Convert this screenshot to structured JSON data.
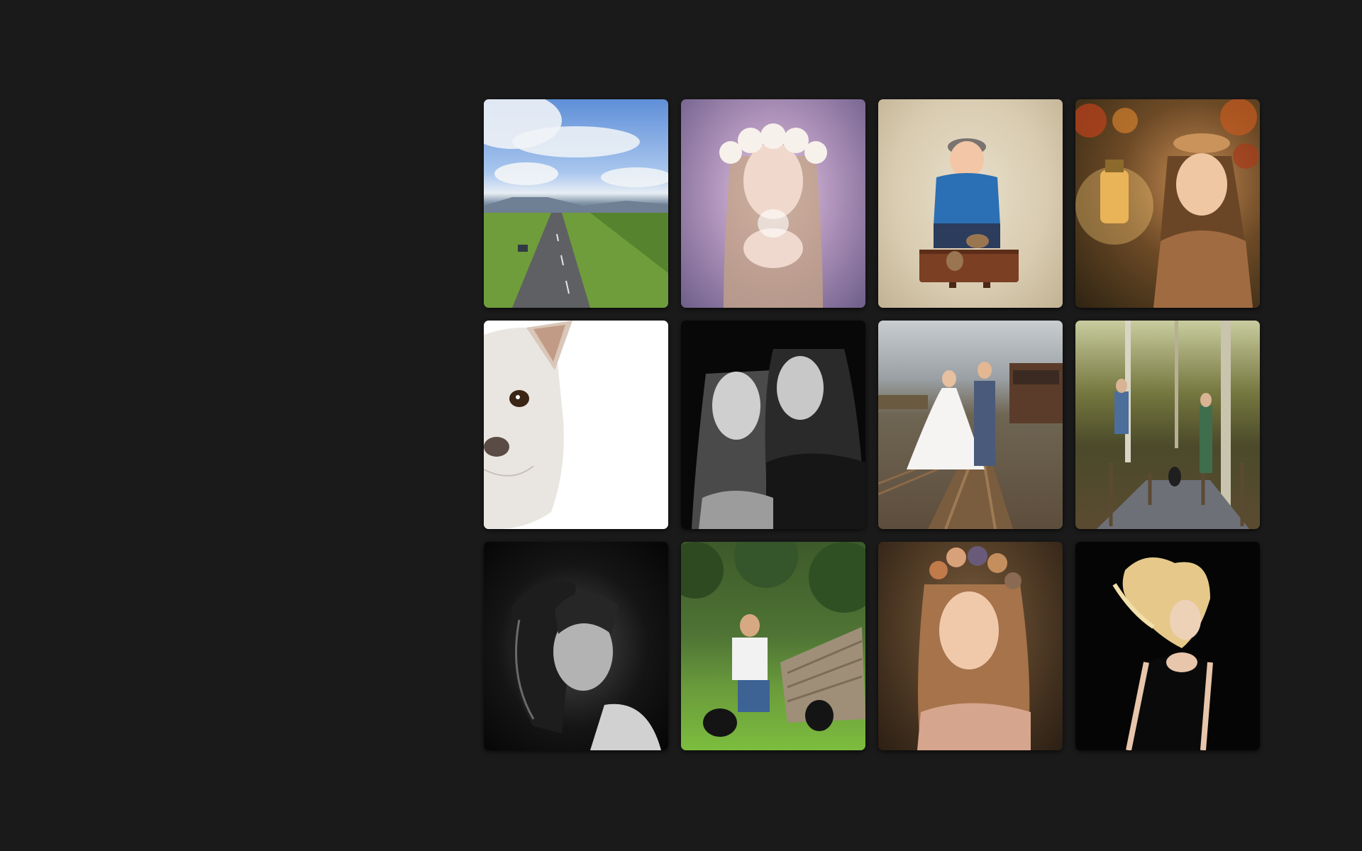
{
  "gallery": {
    "items": [
      {
        "subject": "country-road-landscape"
      },
      {
        "subject": "girl-flower-crown-blowing-glitter"
      },
      {
        "subject": "toddler-on-suitcase"
      },
      {
        "subject": "girl-with-lantern-autumn"
      },
      {
        "subject": "white-dog-peeking"
      },
      {
        "subject": "two-sisters-black-and-white"
      },
      {
        "subject": "wedding-couple-on-railway"
      },
      {
        "subject": "couple-on-forest-bridge-with-dog"
      },
      {
        "subject": "woman-portrait-black-and-white"
      },
      {
        "subject": "man-with-two-black-dogs"
      },
      {
        "subject": "girl-with-floral-headband"
      },
      {
        "subject": "woman-hair-flip"
      }
    ]
  }
}
